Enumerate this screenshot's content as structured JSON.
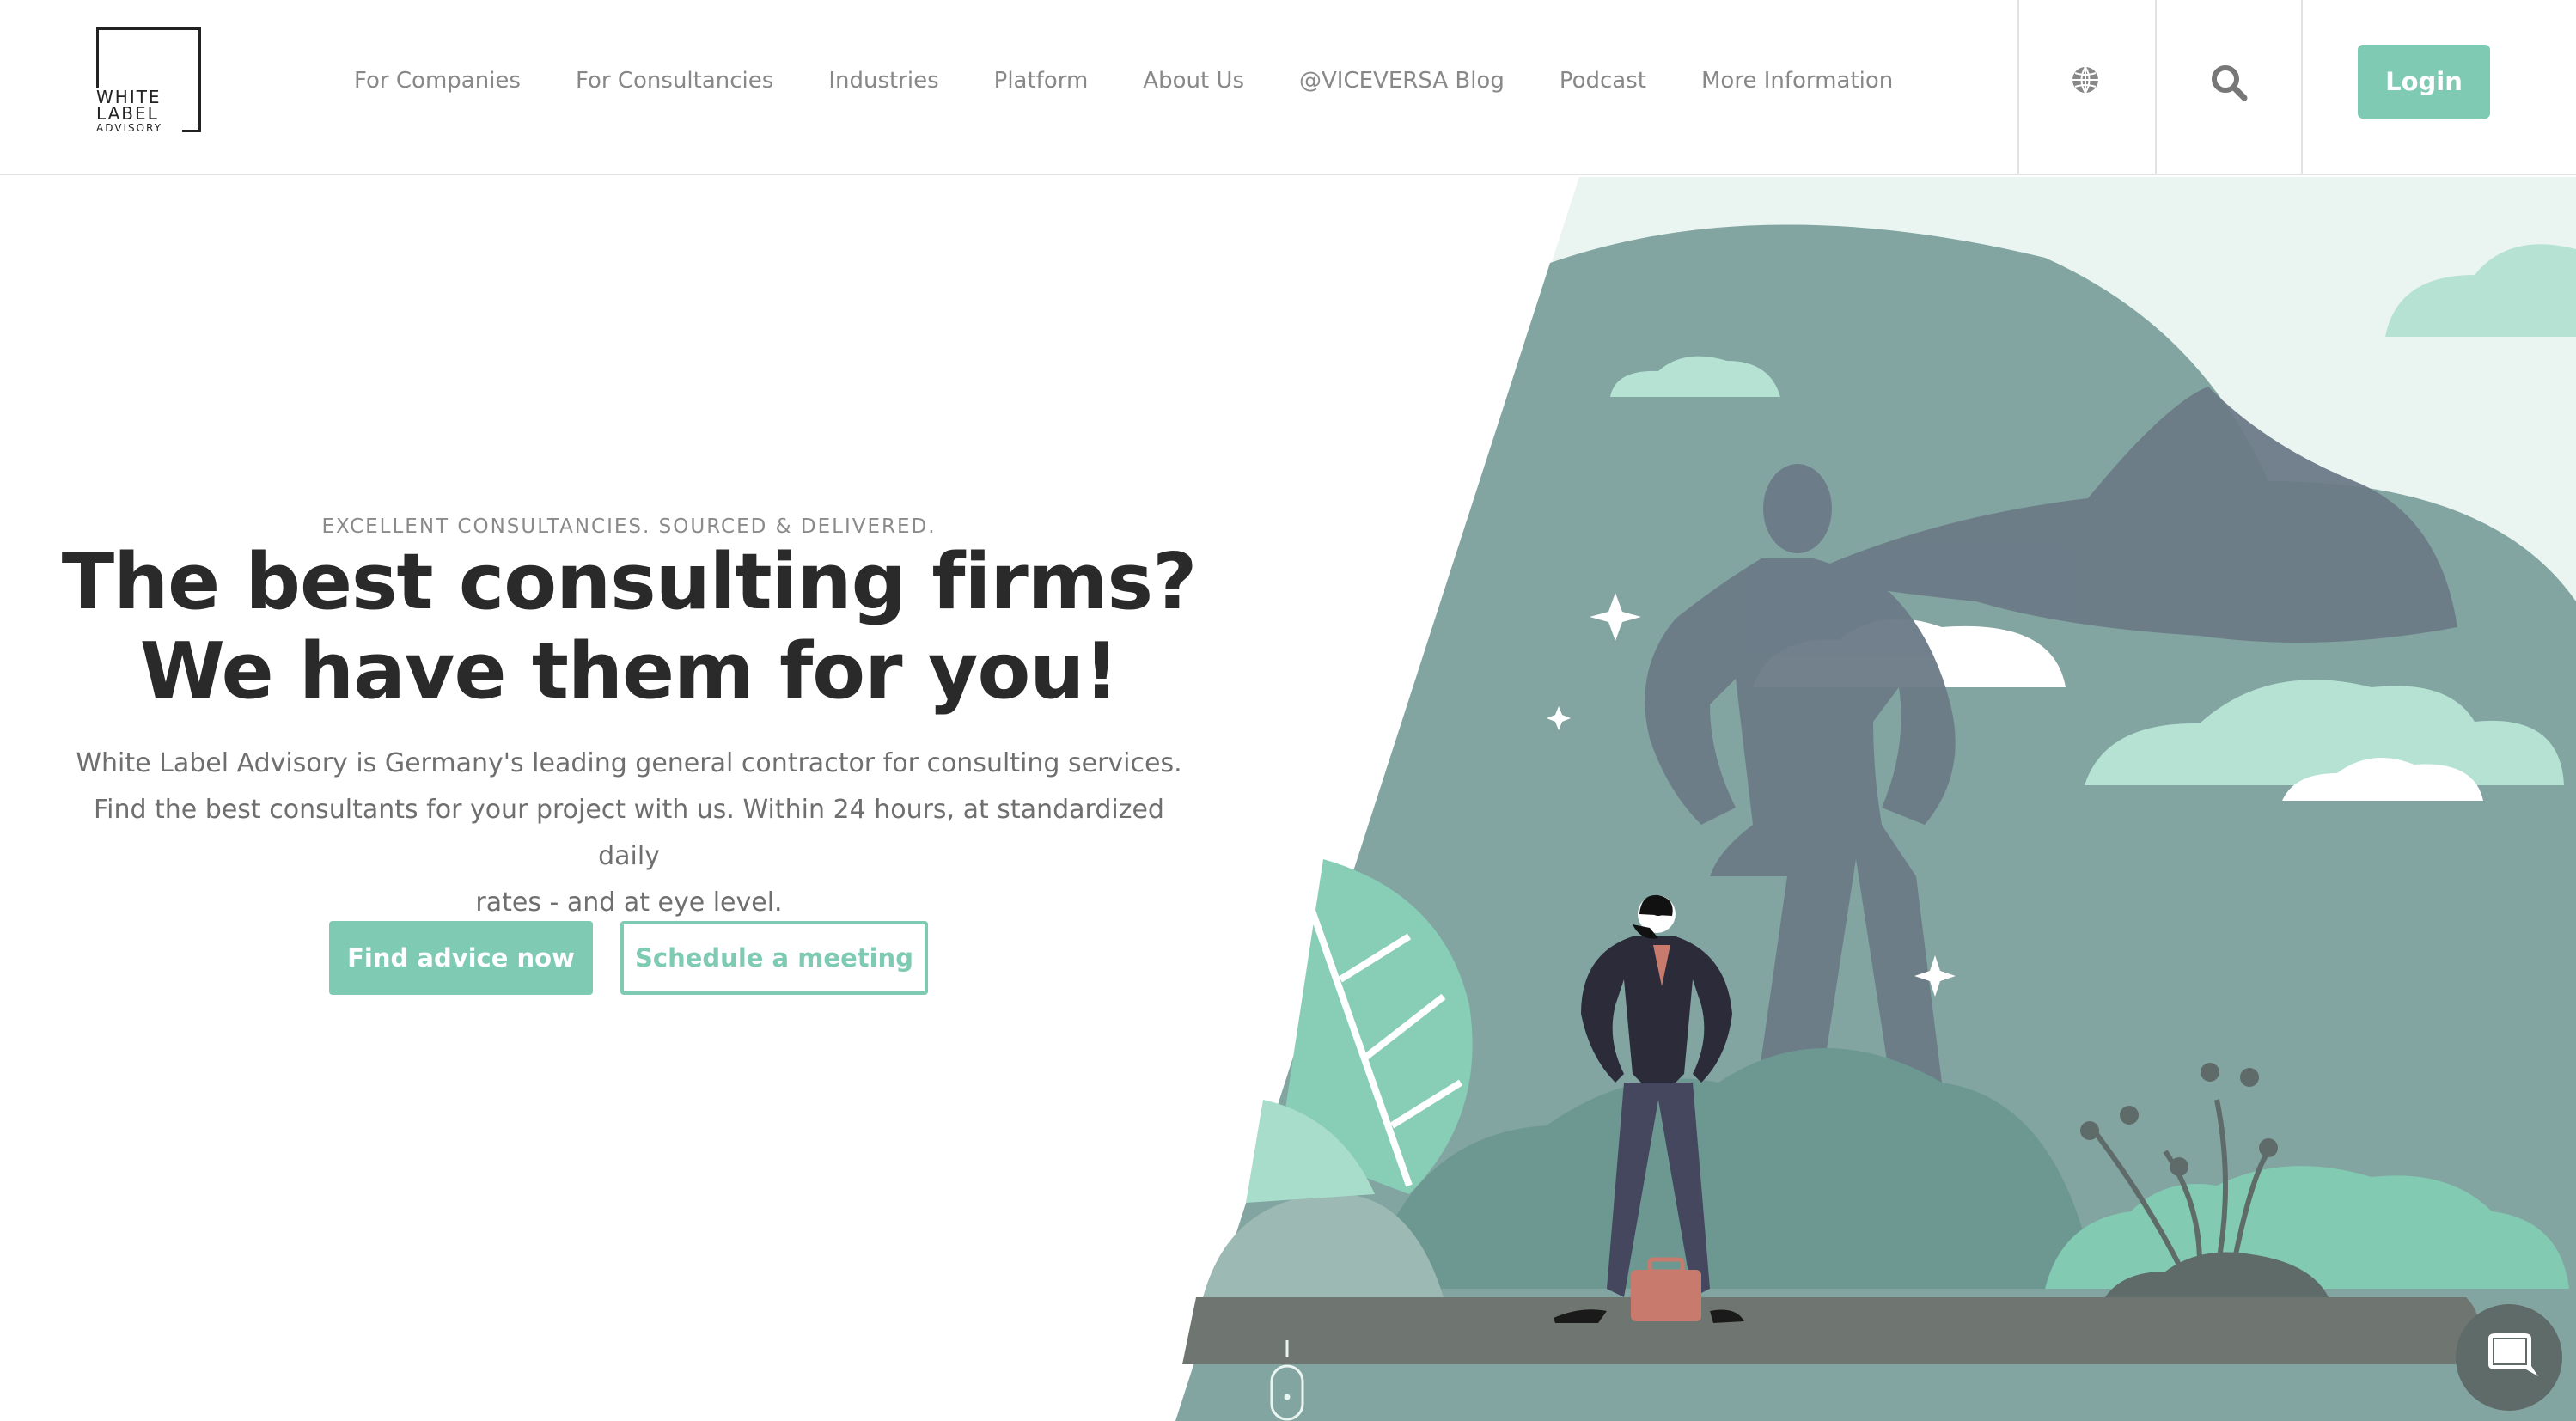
{
  "logo": {
    "line1": "WHITE",
    "line2": "LABEL",
    "line3": "ADVISORY"
  },
  "nav": {
    "items": [
      {
        "label": "For Companies"
      },
      {
        "label": "For Consultancies"
      },
      {
        "label": "Industries"
      },
      {
        "label": "Platform"
      },
      {
        "label": "About Us"
      },
      {
        "label": "@VICEVERSA Blog"
      },
      {
        "label": "Podcast"
      },
      {
        "label": "More Information"
      }
    ],
    "globe_icon": "globe-icon",
    "search_icon": "search-icon",
    "login_label": "Login"
  },
  "hero": {
    "eyebrow": "EXCELLENT CONSULTANCIES. SOURCED & DELIVERED.",
    "headline_line1": "The best consulting firms?",
    "headline_line2": "We have them for you!",
    "desc_line1": "White Label Advisory is Germany's leading general contractor for consulting services.",
    "desc_line2": "Find the best consultants for your project with us. Within 24 hours, at standardized daily",
    "desc_line3": "rates - and at eye level.",
    "primary_button": "Find advice now",
    "secondary_button": "Schedule a meeting"
  },
  "colors": {
    "accent": "#7ecab3",
    "illustration_bg": "#82a5a1",
    "light_mint": "#eaf5f1",
    "headline": "#2a2a2a"
  },
  "widgets": {
    "scroll_indicator_icon": "mouse-scroll-icon",
    "chat_icon": "chat-bubble-icon"
  }
}
